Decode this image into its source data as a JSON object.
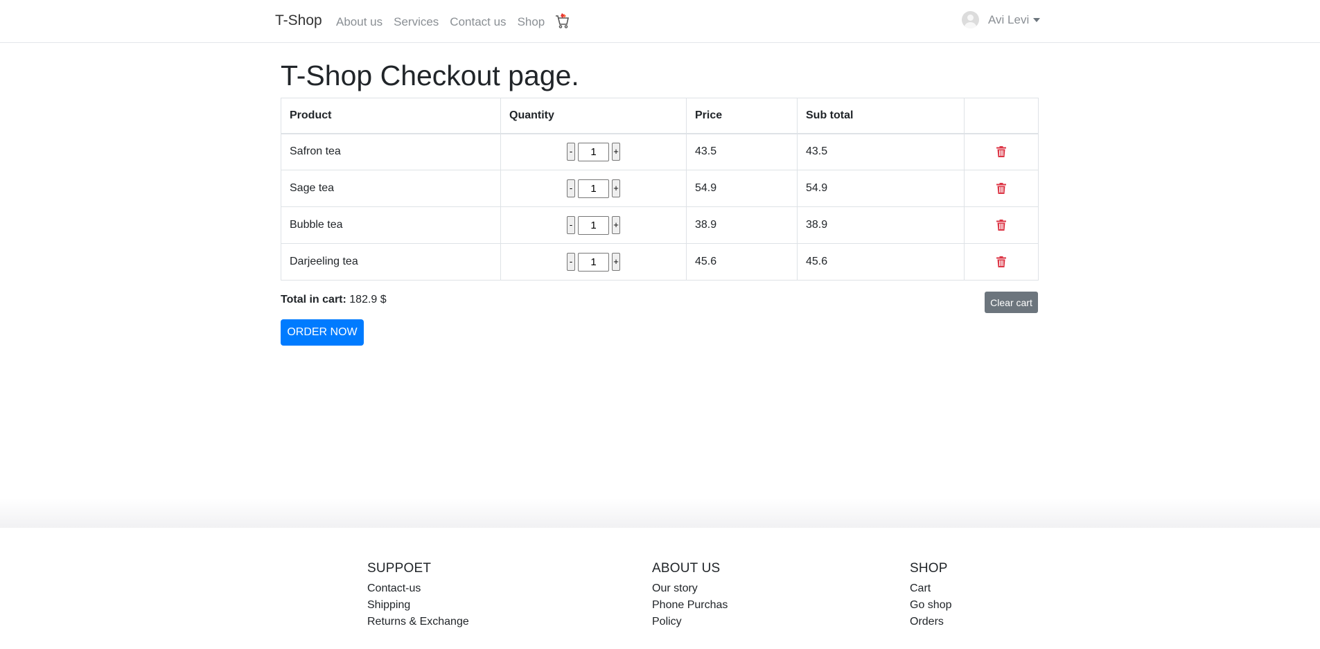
{
  "navbar": {
    "brand": "T-Shop",
    "links": [
      "About us",
      "Services",
      "Contact us",
      "Shop"
    ],
    "cart_icon": "shopping-cart-icon",
    "user_name": "Avi Levi"
  },
  "main": {
    "title": "T-Shop Checkout page.",
    "table": {
      "headers": [
        "Product",
        "Quantity",
        "Price",
        "Sub total",
        ""
      ],
      "rows": [
        {
          "product": "Safron tea",
          "quantity": "1",
          "price": "43.5",
          "subtotal": "43.5"
        },
        {
          "product": "Sage tea",
          "quantity": "1",
          "price": "54.9",
          "subtotal": "54.9"
        },
        {
          "product": "Bubble tea",
          "quantity": "1",
          "price": "38.9",
          "subtotal": "38.9"
        },
        {
          "product": "Darjeeling tea",
          "quantity": "1",
          "price": "45.6",
          "subtotal": "45.6"
        }
      ],
      "minus_label": "-",
      "plus_label": "+",
      "delete_icon": "trash-icon"
    },
    "total_label": "Total in cart:",
    "total_value": " 182.9 $",
    "clear_cart_label": "Clear cart",
    "order_now_label": "ORDER NOW"
  },
  "footer": {
    "columns": [
      {
        "title": "SUPPOET",
        "links": [
          "Contact-us",
          "Shipping",
          "Returns & Exchange"
        ]
      },
      {
        "title": "ABOUT US",
        "links": [
          "Our story",
          "Phone Purchas",
          "Policy"
        ]
      },
      {
        "title": "SHOP",
        "links": [
          "Cart",
          "Go shop",
          "Orders"
        ]
      }
    ]
  },
  "colors": {
    "primary": "#007bff",
    "secondary": "#6c757d",
    "danger": "#dc3545"
  }
}
